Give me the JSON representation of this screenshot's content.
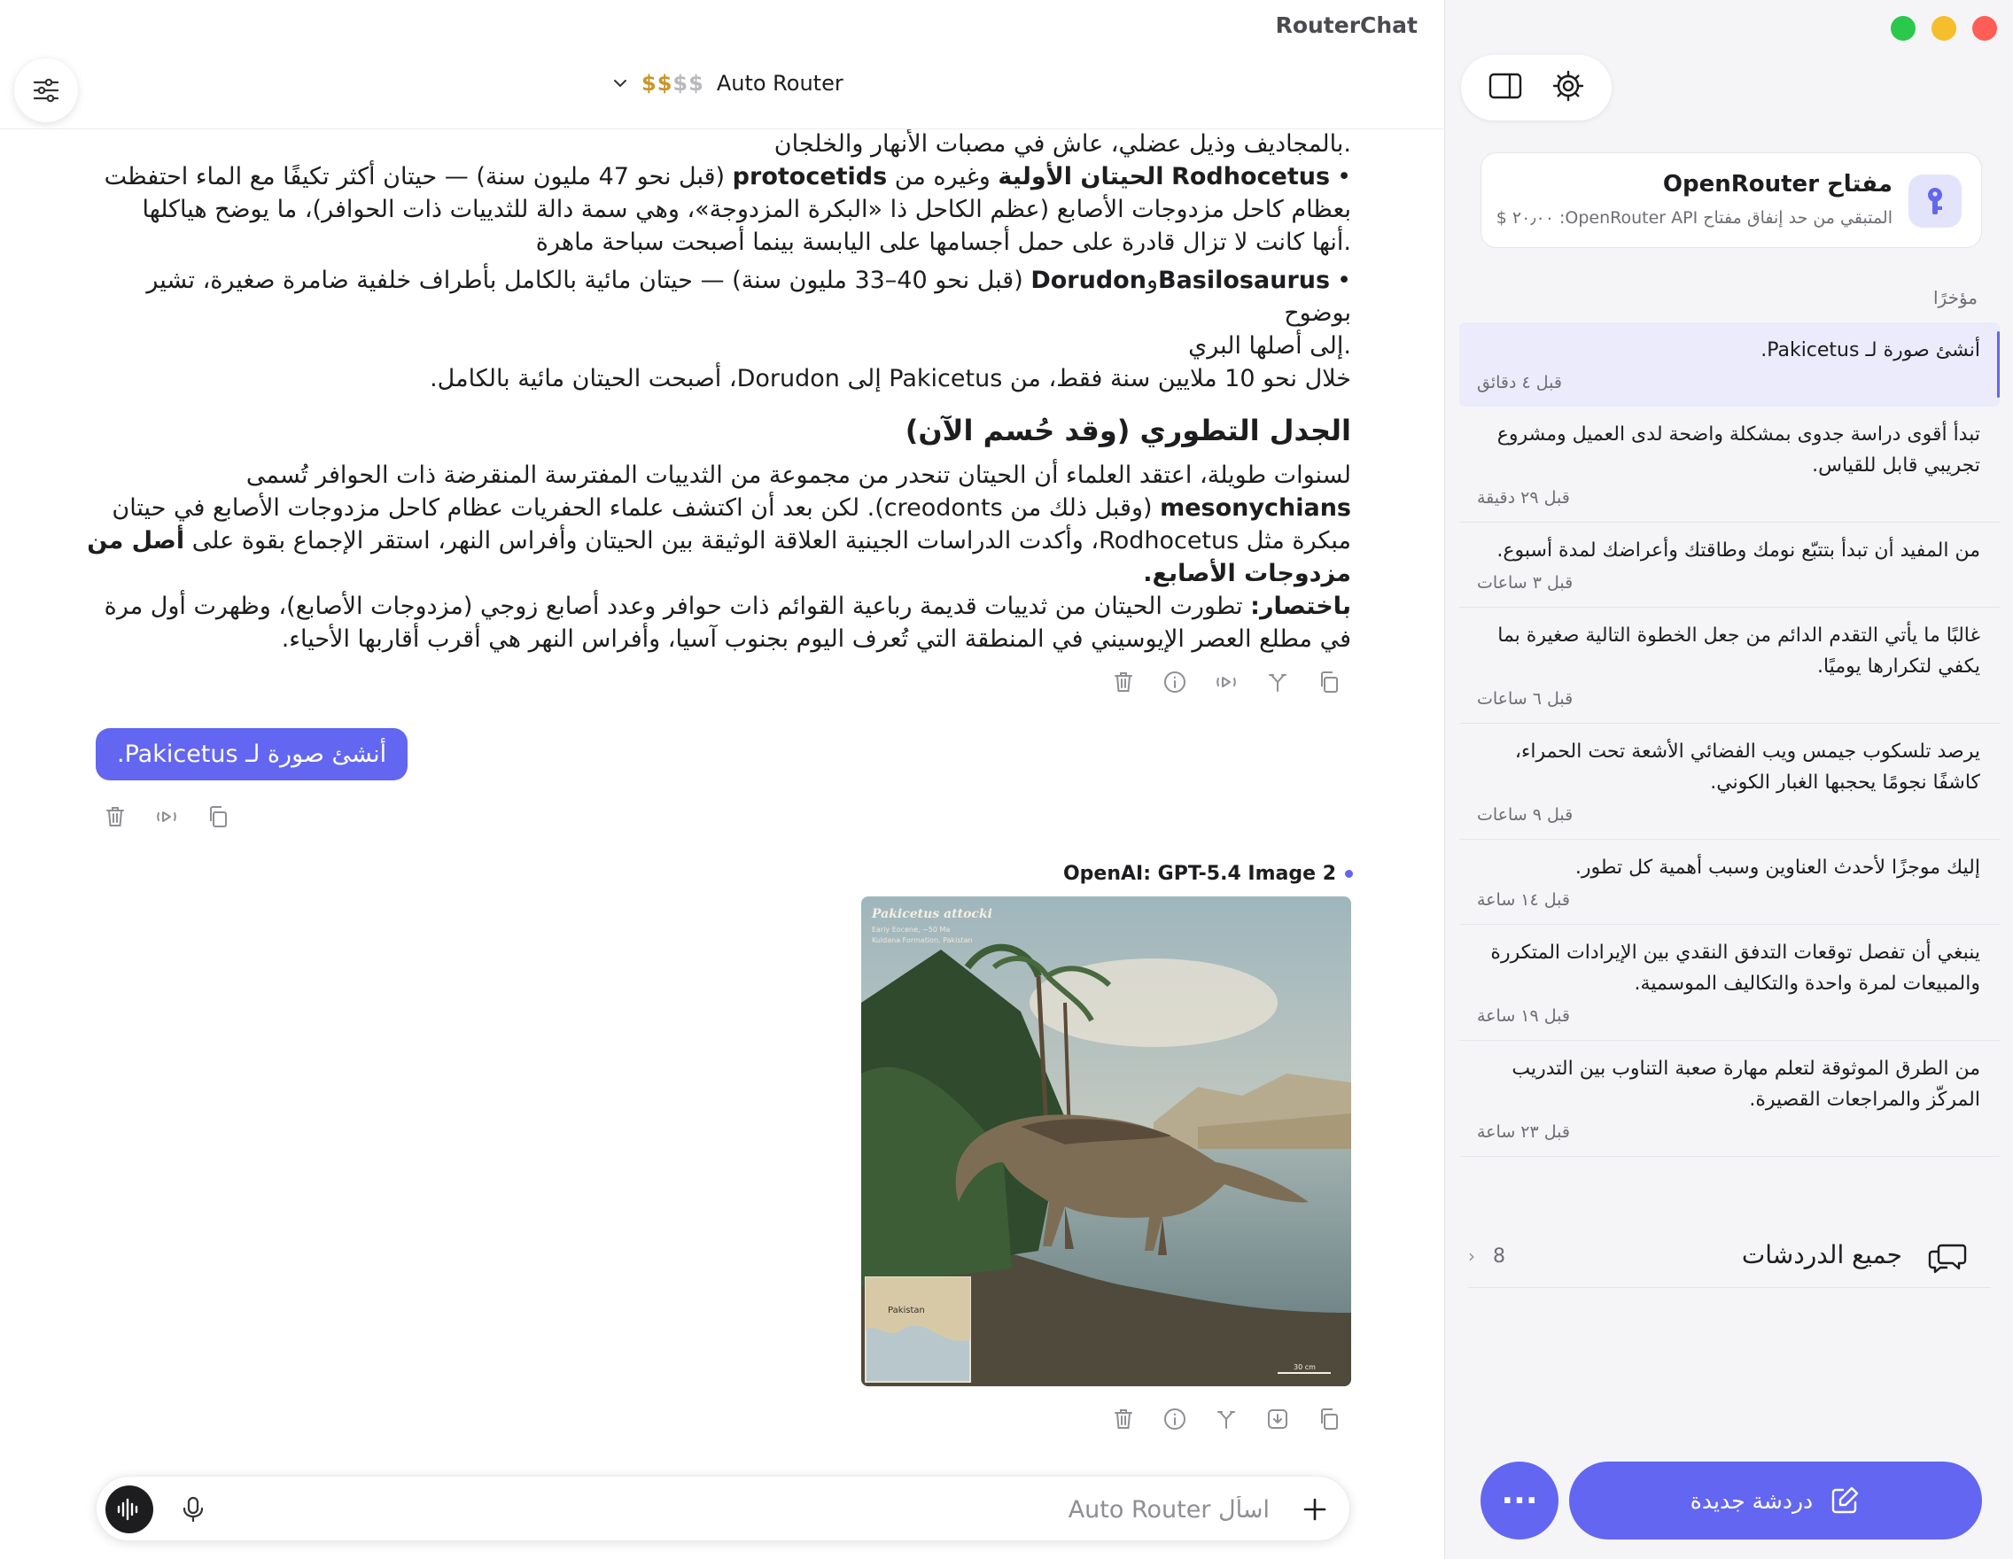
{
  "app": {
    "title": "RouterChat"
  },
  "header": {
    "model_name": "Auto Router",
    "price_on": "$$",
    "price_off": "$$"
  },
  "assistant_message": {
    "lines": {
      "l1": ".بالمجاديف وذيل عضلي، عاش في مصبات الأنهار والخلجان",
      "b1_name": "Rodhocetus",
      "b1_bold": "الحيتان الأولية",
      "b1_mid": "وغيره من",
      "b1_latin": "protocetids",
      "b1_rest": "(قبل نحو 47 مليون سنة) — حيتان أكثر تكيفًا مع الماء احتفظت",
      "b1_l2": "بعظام كاحل مزدوجات الأصابع (عظم الكاحل ذا «البكرة المزدوجة»، وهي سمة دالة للثدييات ذات الحوافر)، ما يوضح هياكلها",
      "b1_l3": ".أنها كانت لا تزال قادرة على حمل أجسامها على اليابسة بينما أصبحت سباحة ماهرة",
      "b2_name1": "Basilosaurus",
      "b2_and": "و",
      "b2_name2": "Dorudon",
      "b2_rest": "(قبل نحو 40–33 مليون سنة) — حيتان مائية بالكامل بأطراف خلفية ضامرة صغيرة، تشير بوضوح",
      "b2_l2": ".إلى أصلها البري",
      "summary_line": "خلال نحو 10 ملايين سنة فقط، من Pakicetus إلى Dorudon، أصبحت الحيتان مائية بالكامل.",
      "heading": "الجدل التطوري (وقد حُسم الآن)",
      "p1_l1": "لسنوات طويلة، اعتقد العلماء أن الحيتان تنحدر من مجموعة من الثدييات المفترسة المنقرضة ذات الحوافر تُسمى",
      "p1_bold": "mesonychians",
      "p1_l2": "(وقبل ذلك من creodonts). لكن بعد أن اكتشف علماء الحفريات عظام كاحل مزدوجات الأصابع في حيتان",
      "p1_l3": "مبكرة مثل Rodhocetus، وأكدت الدراسات الجينية العلاقة الوثيقة بين الحيتان وأفراس النهر، استقر الإجماع بقوة على",
      "p1_bold2": "أصل من",
      "p1_bold3": "مزدوجات الأصابع",
      "p2_bold": "باختصار:",
      "p2_l1": "تطورت الحيتان من ثدييات قديمة رباعية القوائم ذات حوافر وعدد أصابع زوجي (مزدوجات الأصابع)، وظهرت أول مرة",
      "p2_l2": "في مطلع العصر الإيوسيني في المنطقة التي تُعرف اليوم بجنوب آسيا، وأفراس النهر هي أقرب أقاربها الأحياء."
    }
  },
  "user_message": {
    "text": "أنشئ صورة لـ Pakicetus."
  },
  "image_message": {
    "model_tag": "OpenAI: GPT-5.4 Image 2",
    "image_caption_title": "Pakicetus attocki",
    "image_caption_sub1": "Early Eocene, ~50 Ma",
    "image_caption_sub2": "Kuldana Formation, Pakistan",
    "map_label": "Pakistan",
    "scale_label": "30 cm"
  },
  "input": {
    "placeholder": "اسأل Auto Router"
  },
  "sidebar": {
    "key_card": {
      "title": "مفتاح OpenRouter",
      "subtitle": "المتبقي من حد إنفاق مفتاح OpenRouter API: ٢٠٫٠٠ $"
    },
    "recent_label": "مؤخرًا",
    "chats": [
      {
        "title": "أنشئ صورة لـ Pakicetus.",
        "time": "قبل ٤ دقائق",
        "active": true
      },
      {
        "title": "تبدأ أقوى دراسة جدوى بمشكلة واضحة لدى العميل ومشروع تجريبي قابل للقياس.",
        "time": "قبل ٢٩ دقيقة"
      },
      {
        "title": "من المفيد أن تبدأ بتتبّع نومك وطاقتك وأعراضك لمدة أسبوع.",
        "time": "قبل ٣ ساعات"
      },
      {
        "title": "غالبًا ما يأتي التقدم الدائم من جعل الخطوة التالية صغيرة بما يكفي لتكرارها يوميًا.",
        "time": "قبل ٦ ساعات"
      },
      {
        "title": "يرصد تلسكوب جيمس ويب الفضائي الأشعة تحت الحمراء، كاشفًا نجومًا يحجبها الغبار الكوني.",
        "time": "قبل ٩ ساعات"
      },
      {
        "title": "إليك موجزًا لأحدث العناوين وسبب أهمية كل تطور.",
        "time": "قبل ١٤ ساعة"
      },
      {
        "title": "ينبغي أن تفصل توقعات التدفق النقدي بين الإيرادات المتكررة والمبيعات لمرة واحدة والتكاليف الموسمية.",
        "time": "قبل ١٩ ساعة"
      },
      {
        "title": "من الطرق الموثوقة لتعلم مهارة صعبة التناوب بين التدريب المركّز والمراجعات القصيرة.",
        "time": "قبل ٢٣ ساعة"
      }
    ],
    "all_chats": {
      "label": "جميع الدردشات",
      "count": "8",
      "chevron": "›"
    },
    "more_label": "···",
    "new_chat_label": "دردشة جديدة"
  },
  "colors": {
    "accent": "#6366f1",
    "price": "#c9962a"
  }
}
